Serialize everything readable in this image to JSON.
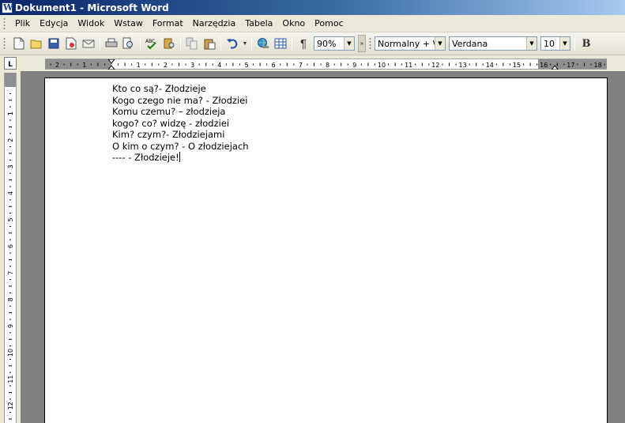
{
  "window": {
    "title": "Dokument1 - Microsoft Word",
    "app_icon": "word-doc-icon"
  },
  "menu": [
    {
      "label": "Plik",
      "name": "menu-plik"
    },
    {
      "label": "Edycja",
      "name": "menu-edycja"
    },
    {
      "label": "Widok",
      "name": "menu-widok"
    },
    {
      "label": "Wstaw",
      "name": "menu-wstaw"
    },
    {
      "label": "Format",
      "name": "menu-format"
    },
    {
      "label": "Narzędzia",
      "name": "menu-narzedzia"
    },
    {
      "label": "Tabela",
      "name": "menu-tabela"
    },
    {
      "label": "Okno",
      "name": "menu-okno"
    },
    {
      "label": "Pomoc",
      "name": "menu-pomoc"
    }
  ],
  "toolbar": {
    "zoom": "90%",
    "style": "Normalny + Ver",
    "font": "Verdana",
    "font_size": "10",
    "bold_label": "B",
    "pilcrow": "¶"
  },
  "ruler": {
    "tab_selector": "L",
    "h_labels": [
      "2",
      "1",
      "1",
      "2",
      "3",
      "4",
      "5",
      "6",
      "7",
      "8",
      "9",
      "10",
      "11",
      "12",
      "13",
      "14",
      "15",
      "16",
      "17",
      "18"
    ],
    "v_labels": [
      "1",
      "1",
      "2",
      "3",
      "4",
      "5",
      "6",
      "7",
      "8",
      "9",
      "10",
      "11",
      "12"
    ]
  },
  "document": {
    "lines": [
      "Kto co są?- Złodzieje",
      "Kogo czego nie ma? - Złodziei",
      "Komu czemu? – złodzieja",
      "kogo? co? widzę - złodziei",
      "Kim? czym?- Złodziejami",
      "O kim o czym? - O złodziejach",
      "---- - Złodzieje!"
    ]
  }
}
